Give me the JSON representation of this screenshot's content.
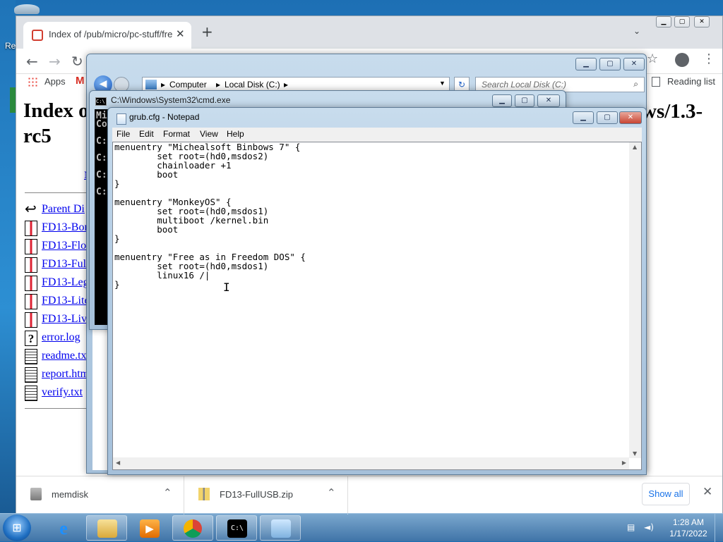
{
  "desktop": {
    "label_fragment": "Re"
  },
  "browser": {
    "tab_title": "Index of /pub/micro/pc-stuff/fre",
    "bookmarks": {
      "apps_label": "Apps",
      "reading_list_label": "Reading list"
    },
    "page": {
      "title_left": "Index o",
      "title_right_1": "ws/1.3-",
      "title_line2": "rc5",
      "column_fragment": "N",
      "files": [
        {
          "name": "Parent Di",
          "icon": "back-arrow-icon"
        },
        {
          "name": "FD13-Bon",
          "icon": "zip-icon"
        },
        {
          "name": "FD13-Flo",
          "icon": "zip-icon"
        },
        {
          "name": "FD13-Ful",
          "icon": "zip-icon"
        },
        {
          "name": "FD13-Leg",
          "icon": "zip-icon"
        },
        {
          "name": "FD13-Lite",
          "icon": "zip-icon"
        },
        {
          "name": "FD13-Liv",
          "icon": "zip-icon"
        },
        {
          "name": "error.log",
          "icon": "unknown-file-icon"
        },
        {
          "name": "readme.tx",
          "icon": "text-file-icon"
        },
        {
          "name": "report.htm",
          "icon": "text-file-icon"
        },
        {
          "name": "verify.txt",
          "icon": "text-file-icon"
        }
      ]
    },
    "downloads": [
      {
        "name": "memdisk"
      },
      {
        "name": "FD13-FullUSB.zip"
      }
    ],
    "show_all_label": "Show all"
  },
  "explorer": {
    "breadcrumb": [
      "Computer",
      "Local Disk (C:)"
    ],
    "search_placeholder": "Search Local Disk (C:)"
  },
  "cmd": {
    "title": "C:\\Windows\\System32\\cmd.exe",
    "lines": [
      "Mi",
      "Co",
      "C:",
      "C:",
      "C:",
      "C:"
    ]
  },
  "notepad": {
    "title": "grub.cfg - Notepad",
    "menu": [
      "File",
      "Edit",
      "Format",
      "View",
      "Help"
    ],
    "content": "menuentry \"Michealsoft Binbows 7\" {\n        set root=(hd0,msdos2)\n        chainloader +1\n        boot\n}\n\nmenuentry \"MonkeyOS\" {\n        set root=(hd0,msdos1)\n        multiboot /kernel.bin\n        boot\n}\n\nmenuentry \"Free as in Freedom DOS\" {\n        set root=(hd0,msdos1)\n        linux16 /|\n}"
  },
  "taskbar": {
    "time": "1:28 AM",
    "date": "1/17/2022",
    "pinned": [
      "internet-explorer-icon",
      "explorer-folder-icon",
      "media-player-icon",
      "chrome-icon",
      "cmd-icon",
      "notepad-icon"
    ]
  }
}
